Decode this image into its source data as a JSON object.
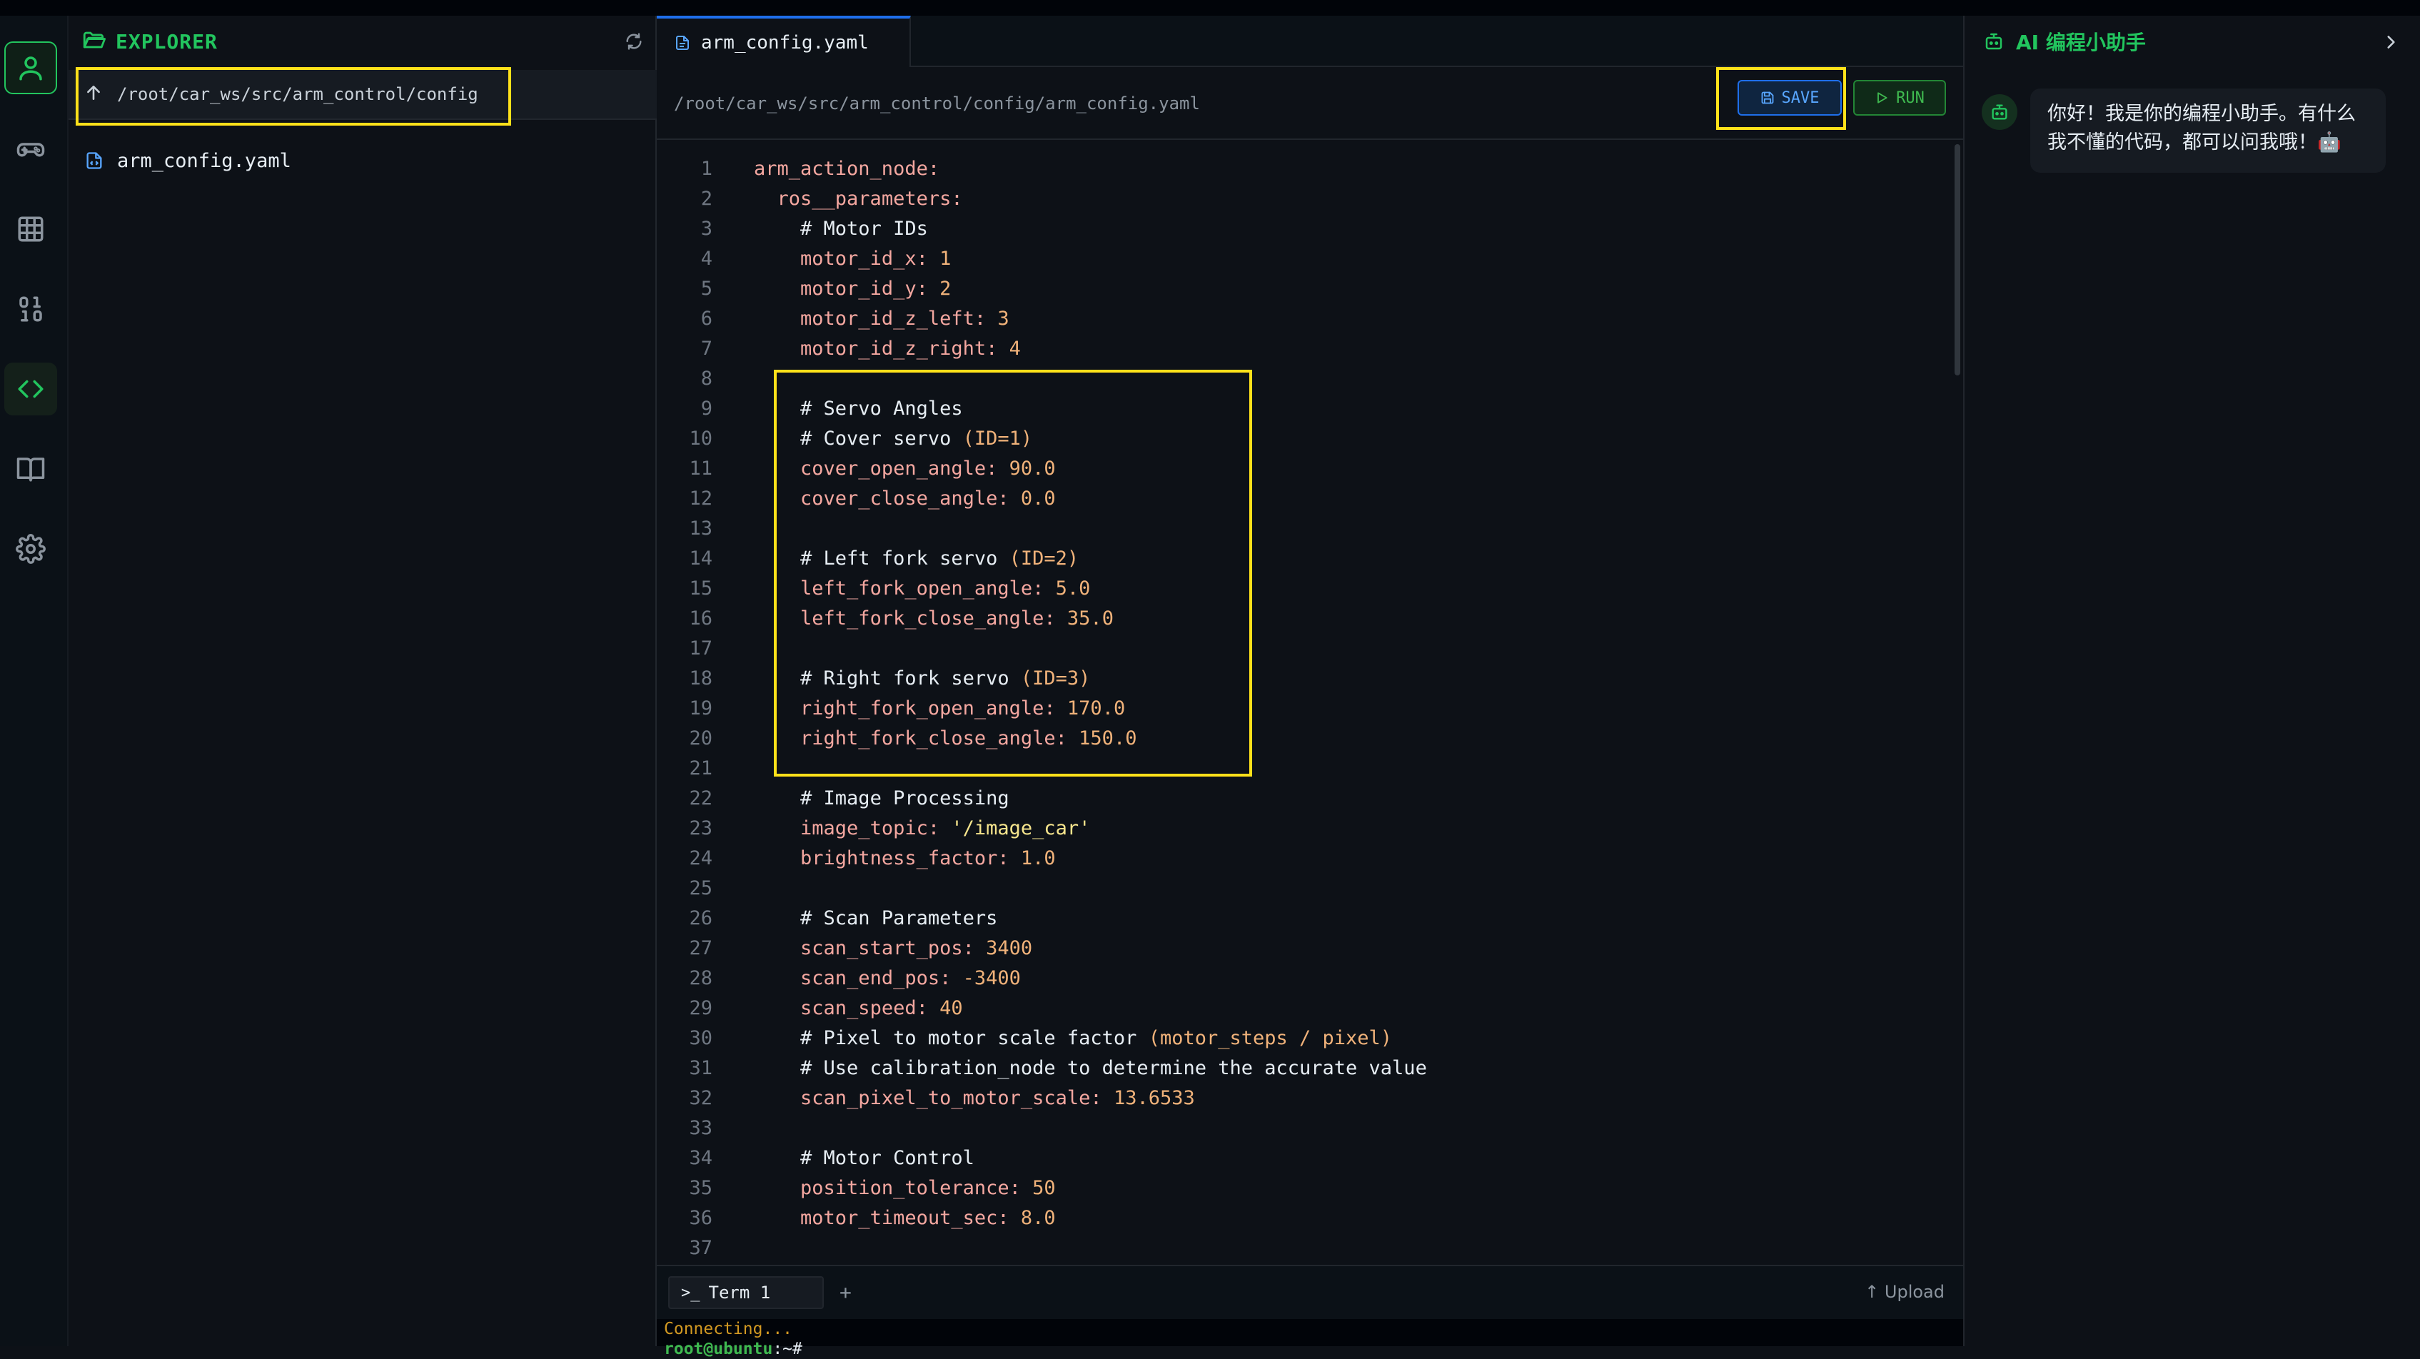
{
  "activity_bar": {
    "items": [
      {
        "name": "user-icon"
      },
      {
        "name": "gamepad-icon"
      },
      {
        "name": "grid-icon"
      },
      {
        "name": "binary-icon"
      },
      {
        "name": "code-icon"
      },
      {
        "name": "book-icon"
      },
      {
        "name": "gear-icon"
      }
    ],
    "accent_color": "#22c55e"
  },
  "explorer": {
    "title": "EXPLORER",
    "path": "/root/car_ws/src/arm_control/config",
    "files": [
      {
        "name": "arm_config.yaml"
      }
    ]
  },
  "editor": {
    "tab_label": "arm_config.yaml",
    "breadcrumb": "/root/car_ws/src/arm_control/config/arm_config.yaml",
    "save_label": "SAVE",
    "run_label": "RUN",
    "lines": [
      {
        "n": "1",
        "text": "arm_action_node:"
      },
      {
        "n": "2",
        "text": "  ros__parameters:"
      },
      {
        "n": "3",
        "text": "    # Motor IDs"
      },
      {
        "n": "4",
        "text": "    motor_id_x: 1"
      },
      {
        "n": "5",
        "text": "    motor_id_y: 2"
      },
      {
        "n": "6",
        "text": "    motor_id_z_left: 3"
      },
      {
        "n": "7",
        "text": "    motor_id_z_right: 4"
      },
      {
        "n": "8",
        "text": ""
      },
      {
        "n": "9",
        "text": "    # Servo Angles"
      },
      {
        "n": "10",
        "text": "    # Cover servo (ID=1)"
      },
      {
        "n": "11",
        "text": "    cover_open_angle: 90.0"
      },
      {
        "n": "12",
        "text": "    cover_close_angle: 0.0"
      },
      {
        "n": "13",
        "text": ""
      },
      {
        "n": "14",
        "text": "    # Left fork servo (ID=2)"
      },
      {
        "n": "15",
        "text": "    left_fork_open_angle: 5.0"
      },
      {
        "n": "16",
        "text": "    left_fork_close_angle: 35.0"
      },
      {
        "n": "17",
        "text": ""
      },
      {
        "n": "18",
        "text": "    # Right fork servo (ID=3)"
      },
      {
        "n": "19",
        "text": "    right_fork_open_angle: 170.0"
      },
      {
        "n": "20",
        "text": "    right_fork_close_angle: 150.0"
      },
      {
        "n": "21",
        "text": ""
      },
      {
        "n": "22",
        "text": "    # Image Processing"
      },
      {
        "n": "23",
        "text": "    image_topic: '/image_car'"
      },
      {
        "n": "24",
        "text": "    brightness_factor: 1.0"
      },
      {
        "n": "25",
        "text": ""
      },
      {
        "n": "26",
        "text": "    # Scan Parameters"
      },
      {
        "n": "27",
        "text": "    scan_start_pos: 3400"
      },
      {
        "n": "28",
        "text": "    scan_end_pos: -3400"
      },
      {
        "n": "29",
        "text": "    scan_speed: 40"
      },
      {
        "n": "30",
        "text": "    # Pixel to motor scale factor (motor_steps / pixel)"
      },
      {
        "n": "31",
        "text": "    # Use calibration_node to determine the accurate value"
      },
      {
        "n": "32",
        "text": "    scan_pixel_to_motor_scale: 13.6533"
      },
      {
        "n": "33",
        "text": ""
      },
      {
        "n": "34",
        "text": "    # Motor Control"
      },
      {
        "n": "35",
        "text": "    position_tolerance: 50"
      },
      {
        "n": "36",
        "text": "    motor_timeout_sec: 8.0"
      },
      {
        "n": "37",
        "text": ""
      }
    ]
  },
  "terminal": {
    "tab_label": "Term 1",
    "add_label": "+",
    "upload_label": "↑ Upload",
    "line1": "Connecting...",
    "prompt_user": "root@ubuntu",
    "prompt_rest": ":~#"
  },
  "ai_panel": {
    "title": "AI 编程小助手",
    "message_line1": "你好！我是你的编程小助手。有什么",
    "message_line2": "我不懂的代码，都可以问我哦！🤖"
  },
  "colors": {
    "highlight": "#ffe11a",
    "key": "#f4a7a0",
    "value": "#f0b27a",
    "string": "#f6e58d"
  }
}
